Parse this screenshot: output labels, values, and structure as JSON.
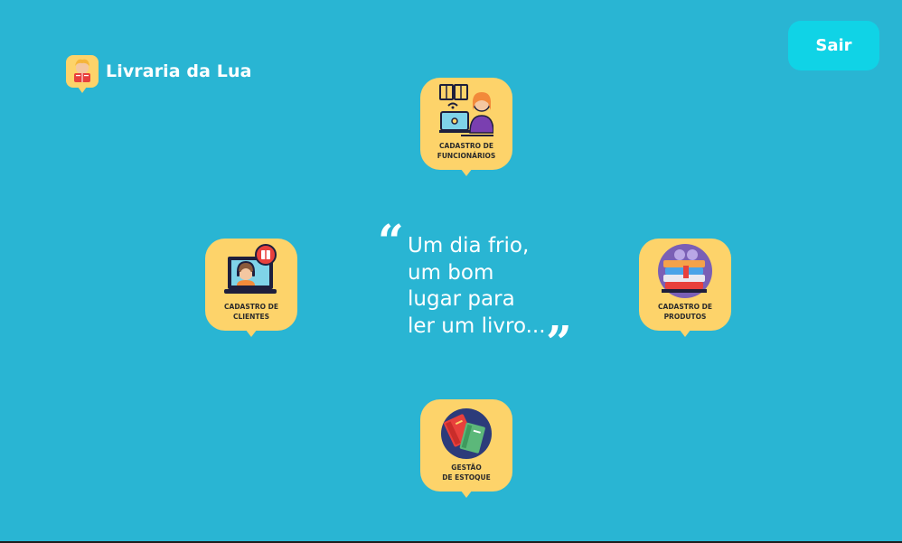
{
  "app": {
    "name": "Livraria da Lua",
    "logo_icon": "girl-reading-book-icon"
  },
  "header": {
    "exit_label": "Sair"
  },
  "quote": {
    "lines": [
      "Um dia frio,",
      "um bom",
      "lugar para",
      "ler um livro..."
    ],
    "open_mark": "“",
    "close_mark": "”"
  },
  "menu": {
    "employees": {
      "label": "CADASTRO DE\nFUNCIONÁRIOS",
      "icon": "employee-laptop-icon"
    },
    "clients": {
      "label": "CADASTRO DE\nCLIENTES",
      "icon": "customer-support-laptop-icon"
    },
    "products": {
      "label": "CADASTRO DE\nPRODUTOS",
      "icon": "stacked-books-icon"
    },
    "stock": {
      "label": "GESTÃO\nDE ESTOQUE",
      "icon": "books-inventory-icon"
    }
  },
  "colors": {
    "background": "#29b5d3",
    "card": "#fdd36a",
    "button": "#10d3e6"
  }
}
